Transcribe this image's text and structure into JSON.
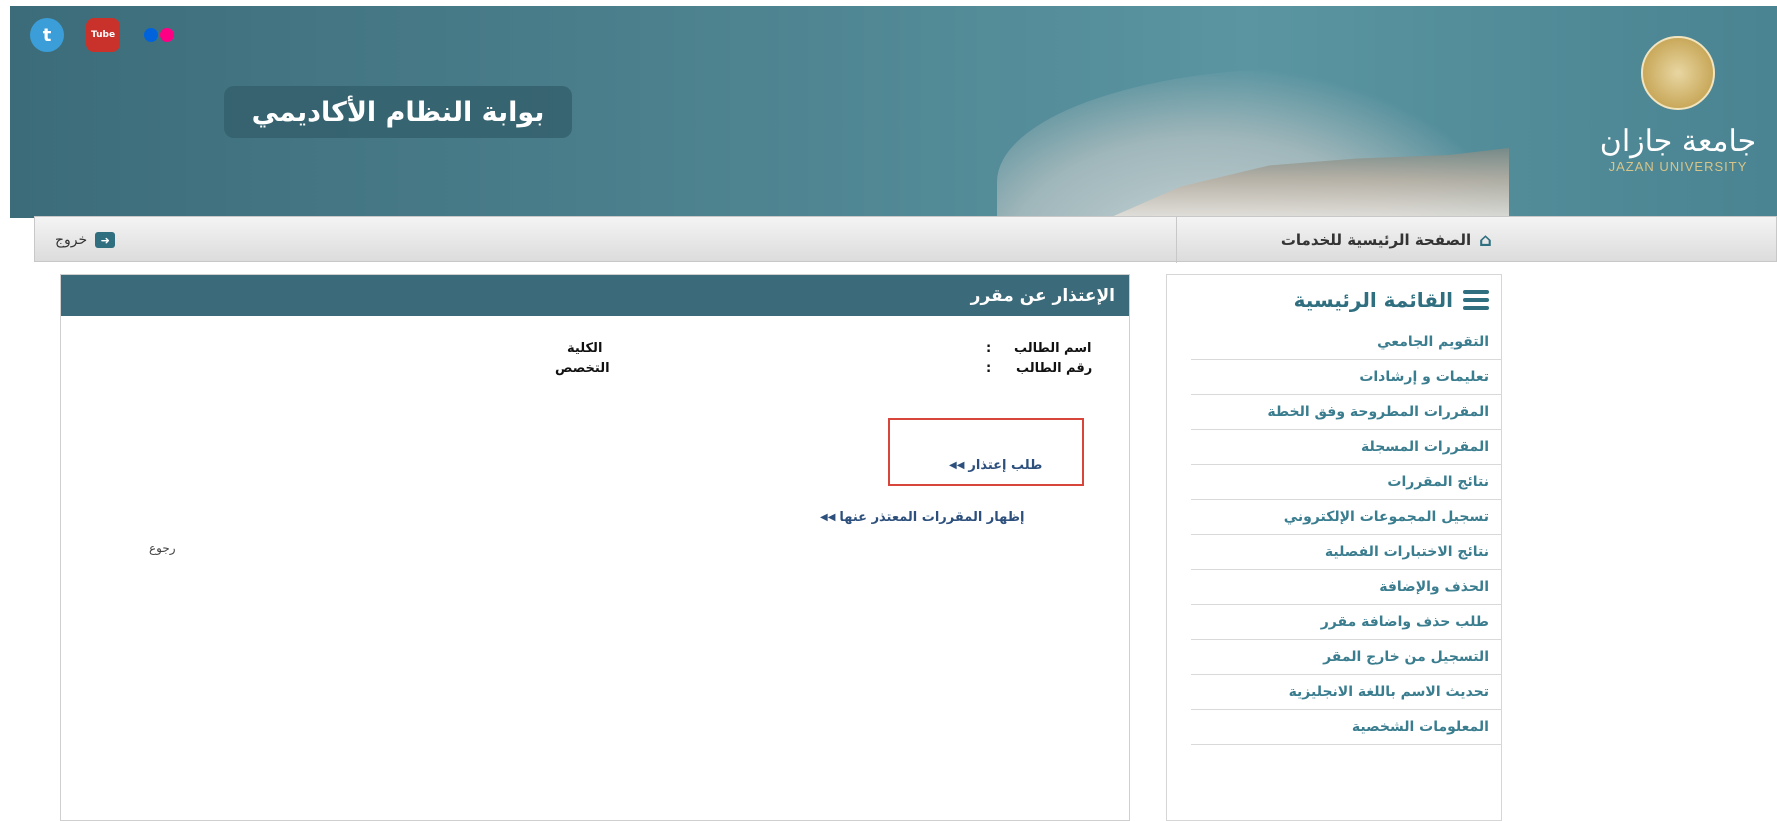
{
  "header": {
    "portal_title": "بوابة النظام الأكاديمي",
    "university_name_ar": "جامعة جازان",
    "university_name_en": "JAZAN UNIVERSITY",
    "social_icons": [
      "twitter-icon",
      "youtube-icon",
      "flickr-icon"
    ]
  },
  "nav": {
    "home_label": "الصفحة الرئيسية للخدمات",
    "logout_label": "خروج"
  },
  "sidebar": {
    "title": "القائمة الرئيسية",
    "items": [
      {
        "label": "التقويم الجامعي"
      },
      {
        "label": "تعليمات و إرشادات"
      },
      {
        "label": "المقررات المطروحة وفق الخطة"
      },
      {
        "label": "المقررات المسجلة"
      },
      {
        "label": "نتائج المقررات"
      },
      {
        "label": "تسجيل المجموعات الإلكتروني"
      },
      {
        "label": "نتائج الاختبارات الفصلية"
      },
      {
        "label": "الحذف والإضافة"
      },
      {
        "label": "طلب حذف واضافة مقرر"
      },
      {
        "label": "التسجيل من خارج المقر"
      },
      {
        "label": "تحديث الاسم باللغة الانجليزية"
      },
      {
        "label": "المعلومات الشخصية"
      }
    ]
  },
  "content": {
    "title": "الإعتذار عن مقرر",
    "student_name_label": "اسم الطالب",
    "student_id_label": "رقم الطالب",
    "separator": ":",
    "college_label": "الكلية",
    "major_label": "التخصص",
    "request_link": "طلب إعتذار",
    "show_courses_link": "إظهار المقررات المعتذر عنها",
    "back_link": "رجوع"
  },
  "colors": {
    "header_bg": "#4b7f8c",
    "panel_header": "#3b6b7a",
    "accent": "#2f6f80",
    "highlight_border": "#d8453a"
  }
}
